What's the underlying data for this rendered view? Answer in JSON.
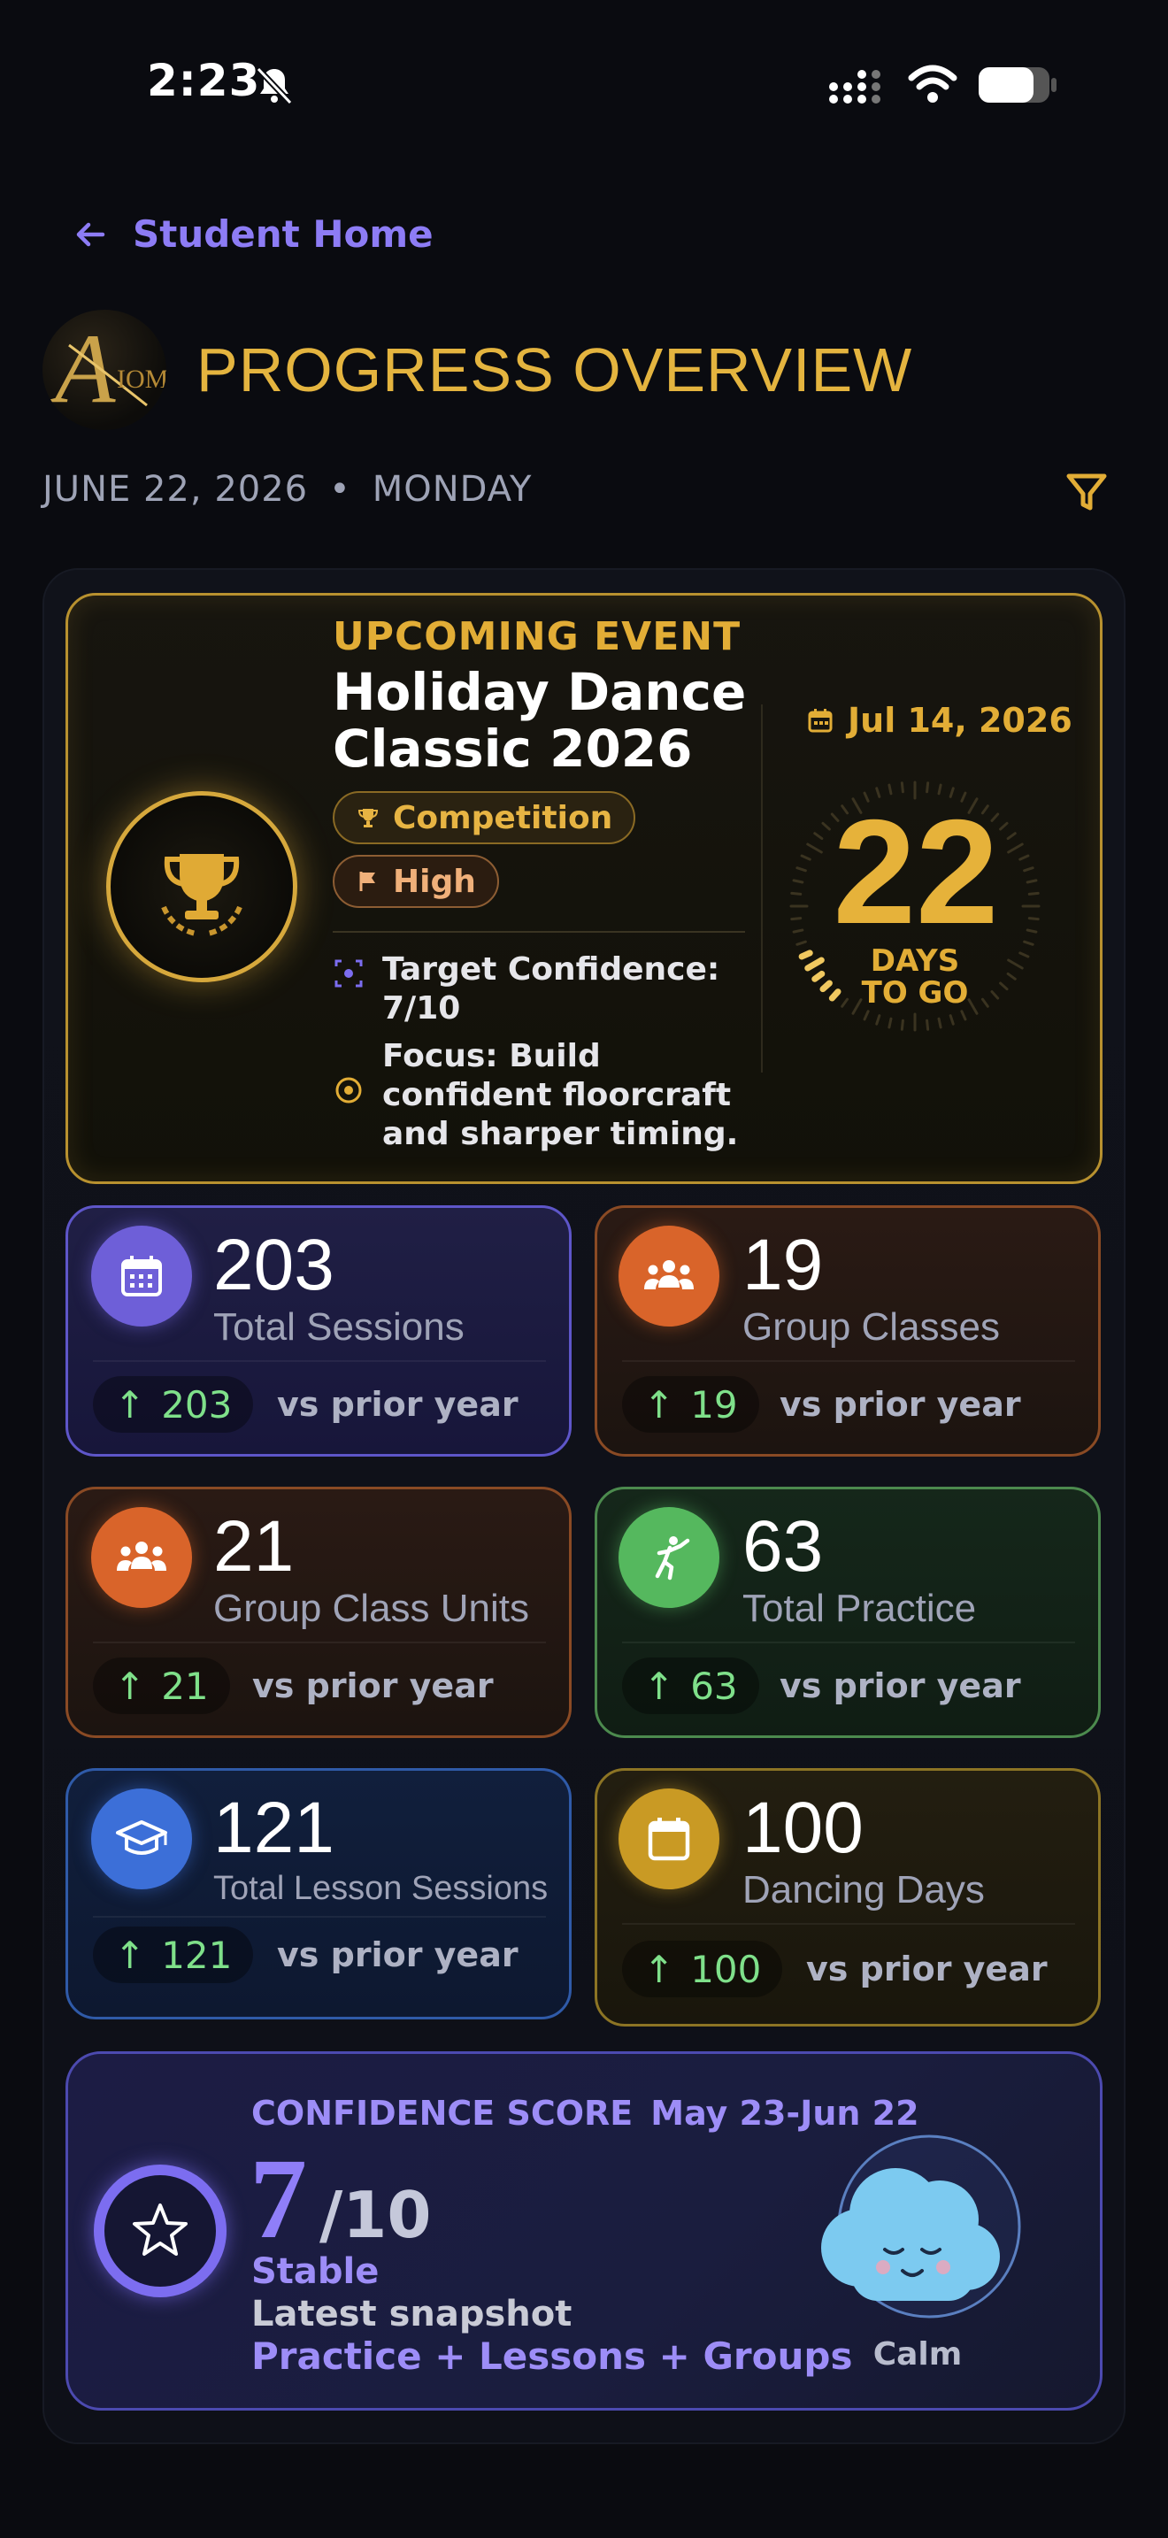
{
  "status_bar": {
    "time": "2:23"
  },
  "nav": {
    "back_label": "Student Home"
  },
  "header": {
    "logo_text": "AXIOM",
    "title": "PROGRESS OVERVIEW",
    "date": "JUNE 22, 2026",
    "separator": "•",
    "weekday": "MONDAY"
  },
  "event": {
    "kicker": "UPCOMING EVENT",
    "name": "Holiday Dance Classic 2026",
    "type_chip": "Competition",
    "priority_chip": "High",
    "target_confidence": "Target Confidence: 7/10",
    "focus": "Focus: Build confident floorcraft and sharper timing.",
    "date": "Jul 14, 2026",
    "days_to_go": "22",
    "days_label_1": "DAYS",
    "days_label_2": "TO GO",
    "accent": "#e2ad36"
  },
  "stats": [
    {
      "value": "203",
      "label": "Total Sessions",
      "delta": "203",
      "vs": "vs prior year",
      "icon": "calendar-grid-icon",
      "color": "#7c6df0"
    },
    {
      "value": "19",
      "label": "Group Classes",
      "delta": "19",
      "vs": "vs prior year",
      "icon": "group-icon",
      "color": "#e06a2c"
    },
    {
      "value": "21",
      "label": "Group Class Units",
      "delta": "21",
      "vs": "vs prior year",
      "icon": "group-icon",
      "color": "#e06a2c"
    },
    {
      "value": "63",
      "label": "Total Practice",
      "delta": "63",
      "vs": "vs prior year",
      "icon": "dancer-icon",
      "color": "#5fc36a"
    },
    {
      "value": "121",
      "label": "Total Lesson Sessions",
      "delta": "121",
      "vs": "vs prior year",
      "icon": "graduation-cap-icon",
      "color": "#3f74e0"
    },
    {
      "value": "100",
      "label": "Dancing Days",
      "delta": "100",
      "vs": "vs prior year",
      "icon": "calendar-icon",
      "color": "#d8a92e"
    }
  ],
  "confidence": {
    "title": "CONFIDENCE SCORE",
    "range": "May 23-Jun 22",
    "score": "7",
    "denominator": "/10",
    "state": "Stable",
    "snapshot": "Latest snapshot",
    "sources": "Practice + Lessons + Groups",
    "mood": "Calm"
  }
}
